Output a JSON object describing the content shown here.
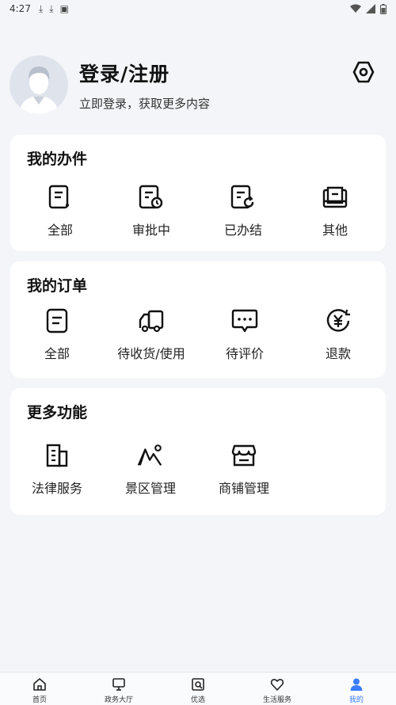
{
  "status_bar": {
    "time": "4:27"
  },
  "profile": {
    "title": "登录/注册",
    "subtitle": "立即登录，获取更多内容"
  },
  "my_affairs": {
    "title": "我的办件",
    "items": [
      {
        "label": "全部",
        "icon": "list-doc-icon"
      },
      {
        "label": "审批中",
        "icon": "doc-clock-icon"
      },
      {
        "label": "已办结",
        "icon": "doc-refresh-icon"
      },
      {
        "label": "其他",
        "icon": "book-icon"
      }
    ]
  },
  "my_orders": {
    "title": "我的订单",
    "items": [
      {
        "label": "全部",
        "icon": "list-doc-icon"
      },
      {
        "label": "待收货/使用",
        "icon": "truck-icon"
      },
      {
        "label": "待评价",
        "icon": "comment-icon"
      },
      {
        "label": "退款",
        "icon": "yen-refund-icon"
      }
    ]
  },
  "more_features": {
    "title": "更多功能",
    "items": [
      {
        "label": "法律服务",
        "icon": "building-icon"
      },
      {
        "label": "景区管理",
        "icon": "mountain-icon"
      },
      {
        "label": "商铺管理",
        "icon": "shop-icon"
      }
    ]
  },
  "tabbar": {
    "active_color": "#3b7cff",
    "tabs": [
      {
        "label": "首页",
        "icon": "home-icon"
      },
      {
        "label": "政务大厅",
        "icon": "monitor-icon"
      },
      {
        "label": "优选",
        "icon": "search-doc-icon"
      },
      {
        "label": "生活服务",
        "icon": "heart-icon"
      },
      {
        "label": "我的",
        "icon": "user-icon"
      }
    ]
  }
}
